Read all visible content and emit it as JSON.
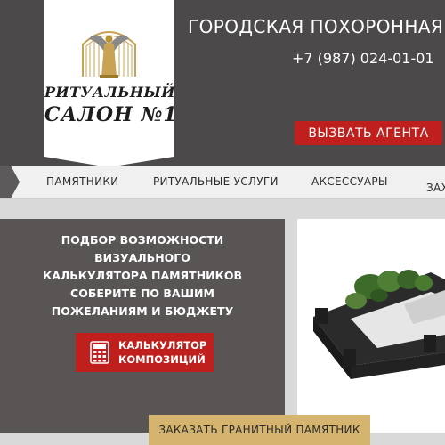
{
  "header": {
    "logo": {
      "line1": "РИТУАЛЬНЫЙ",
      "line2": "САЛОН №1"
    },
    "company_name": "ГОРОДСКАЯ ПОХОРОННАЯ",
    "phone": "+7 (987) 024-01-01",
    "agent_button": "ВЫЗВАТЬ АГЕНТА"
  },
  "nav": {
    "items": [
      {
        "label": "ПАМЯТНИКИ"
      },
      {
        "label": "РИТУАЛЬНЫЕ УСЛУГИ"
      },
      {
        "label": "АКСЕССУАРЫ"
      },
      {
        "label": "ЗАХ"
      }
    ]
  },
  "promo": {
    "line1": "ПОДБОР ВОЗМОЖНОСТИ",
    "line2": "ВИЗУАЛЬНОГО",
    "line3": "КАЛЬКУЛЯТОРА ПАМЯТНИКОВ",
    "line4": "СОБЕРИТЕ ПО ВАШИМ",
    "line5": "ПОЖЕЛАНИЯМ И БЮДЖЕТУ",
    "calc_button_line1": "КАЛЬКУЛЯТОР",
    "calc_button_line2": "КОМПОЗИЦИЙ"
  },
  "order_button": "ЗАКАЗАТЬ ГРАНИТНЫЙ ПАМЯТНИК",
  "colors": {
    "header_bg": "#4b4949",
    "accent_red": "#c0201d",
    "gold": "#d5b46f",
    "panel_bg": "#595555",
    "nav_bg": "#f0f0f0"
  },
  "icons": {
    "logo": "gate-angel-logo",
    "nav_arrow": "nav-arrow-icon",
    "calculator": "calculator-icon"
  }
}
